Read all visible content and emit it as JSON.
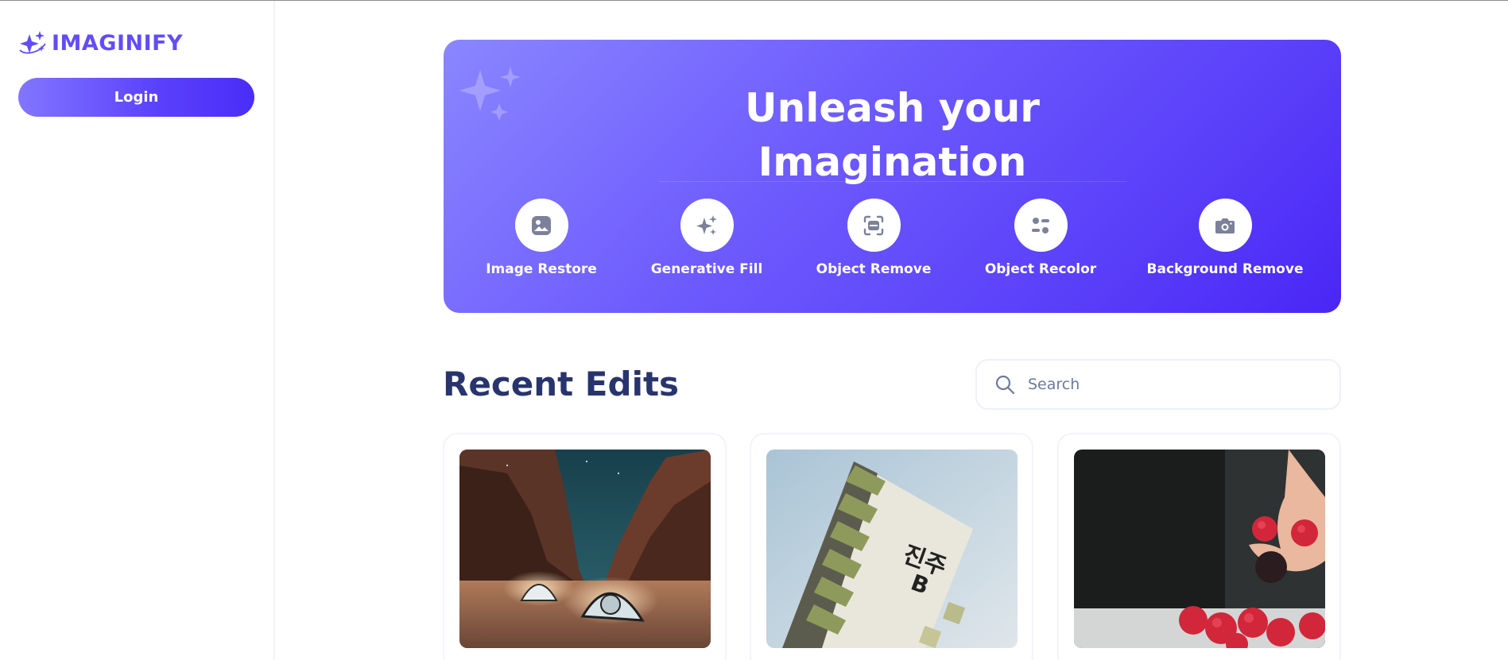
{
  "sidebar": {
    "logo_text": "IMAGINIFY",
    "login_label": "Login"
  },
  "banner": {
    "title_line1": "Unleash your",
    "title_line2": "Imagination",
    "features": [
      {
        "label": "Image Restore",
        "icon": "image-icon"
      },
      {
        "label": "Generative Fill",
        "icon": "sparkles-icon"
      },
      {
        "label": "Object Remove",
        "icon": "scan-icon"
      },
      {
        "label": "Object Recolor",
        "icon": "filter-icon"
      },
      {
        "label": "Background Remove",
        "icon": "camera-icon"
      }
    ]
  },
  "recent": {
    "title": "Recent Edits",
    "search_placeholder": "Search"
  },
  "colors": {
    "accent": "#624cf5",
    "heading": "#28356d",
    "icon_gray": "#7c8199"
  }
}
